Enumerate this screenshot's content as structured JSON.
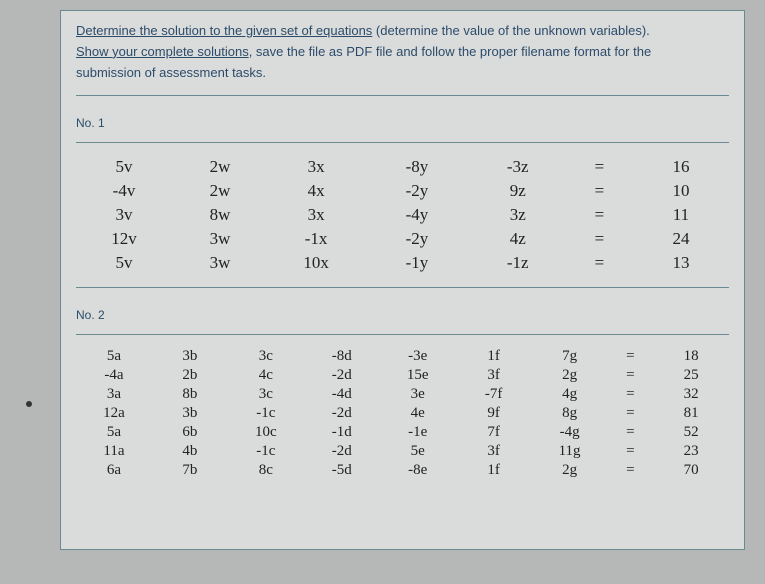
{
  "instructions": {
    "line1a": "Determine the solution to the given set of equations",
    "line1b": "(determine the value of the unknown variables).",
    "line2a": "Show your complete solutions",
    "line2b": ", save the file as PDF file and follow the proper filename format for the",
    "line3": "submission of assessment tasks."
  },
  "section1_label": "No. 1",
  "section2_label": "No. 2",
  "eq1": [
    {
      "c1": "5v",
      "c2": "2w",
      "c3": "3x",
      "c4": "-8y",
      "c5": "-3z",
      "eq": "=",
      "c6": "16"
    },
    {
      "c1": "-4v",
      "c2": "2w",
      "c3": "4x",
      "c4": "-2y",
      "c5": "9z",
      "eq": "=",
      "c6": "10"
    },
    {
      "c1": "3v",
      "c2": "8w",
      "c3": "3x",
      "c4": "-4y",
      "c5": "3z",
      "eq": "=",
      "c6": "11"
    },
    {
      "c1": "12v",
      "c2": "3w",
      "c3": "-1x",
      "c4": "-2y",
      "c5": "4z",
      "eq": "=",
      "c6": "24"
    },
    {
      "c1": "5v",
      "c2": "3w",
      "c3": "10x",
      "c4": "-1y",
      "c5": "-1z",
      "eq": "=",
      "c6": "13"
    }
  ],
  "eq2": [
    {
      "c1": "5a",
      "c2": "3b",
      "c3": "3c",
      "c4": "-8d",
      "c5": "-3e",
      "c6": "1f",
      "c7": "7g",
      "eq": "=",
      "c8": "18"
    },
    {
      "c1": "-4a",
      "c2": "2b",
      "c3": "4c",
      "c4": "-2d",
      "c5": "15e",
      "c6": "3f",
      "c7": "2g",
      "eq": "=",
      "c8": "25"
    },
    {
      "c1": "3a",
      "c2": "8b",
      "c3": "3c",
      "c4": "-4d",
      "c5": "3e",
      "c6": "-7f",
      "c7": "4g",
      "eq": "=",
      "c8": "32"
    },
    {
      "c1": "12a",
      "c2": "3b",
      "c3": "-1c",
      "c4": "-2d",
      "c5": "4e",
      "c6": "9f",
      "c7": "8g",
      "eq": "=",
      "c8": "81"
    },
    {
      "c1": "5a",
      "c2": "6b",
      "c3": "10c",
      "c4": "-1d",
      "c5": "-1e",
      "c6": "7f",
      "c7": "-4g",
      "eq": "=",
      "c8": "52"
    },
    {
      "c1": "11a",
      "c2": "4b",
      "c3": "-1c",
      "c4": "-2d",
      "c5": "5e",
      "c6": "3f",
      "c7": "11g",
      "eq": "=",
      "c8": "23"
    },
    {
      "c1": "6a",
      "c2": "7b",
      "c3": "8c",
      "c4": "-5d",
      "c5": "-8e",
      "c6": "1f",
      "c7": "2g",
      "eq": "=",
      "c8": "70"
    }
  ]
}
